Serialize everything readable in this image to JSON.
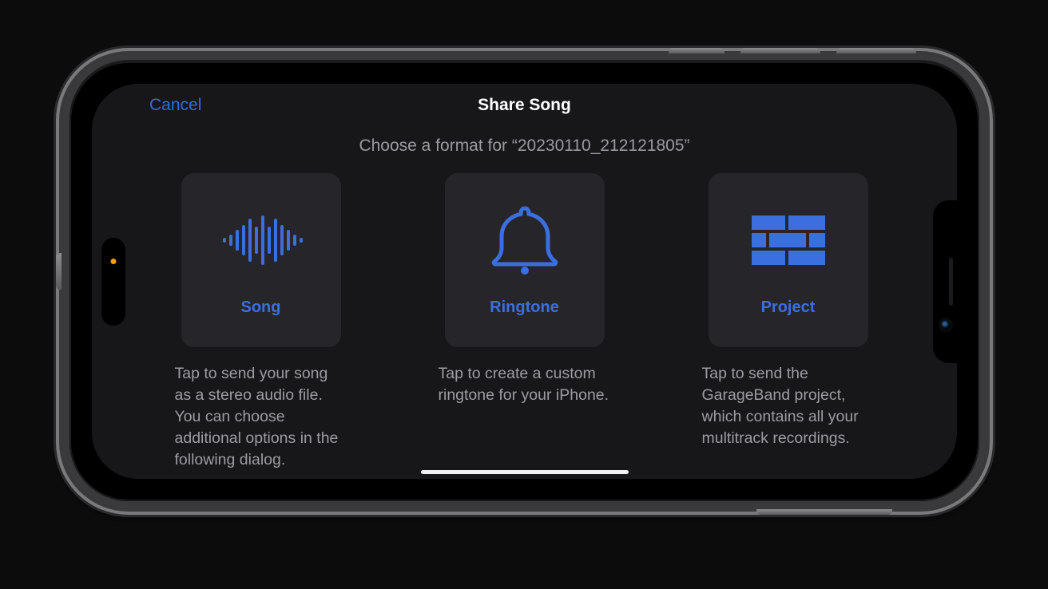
{
  "navbar": {
    "cancel": "Cancel",
    "title": "Share Song"
  },
  "subtitle": "Choose a format for “20230110_212121805”",
  "options": {
    "song": {
      "label": "Song",
      "description": "Tap to send your song as a stereo audio file. You can choose additional options in the following dialog."
    },
    "ringtone": {
      "label": "Ringtone",
      "description": "Tap to create a custom ringtone for your iPhone."
    },
    "project": {
      "label": "Project",
      "description": "Tap to send the GarageBand project, which contains all your multitrack recordings."
    }
  },
  "colors": {
    "accent": "#3b6fe0",
    "link": "#2e6ede",
    "card": "#26262a",
    "screen": "#17171a",
    "subtext": "#9a9aa0"
  }
}
